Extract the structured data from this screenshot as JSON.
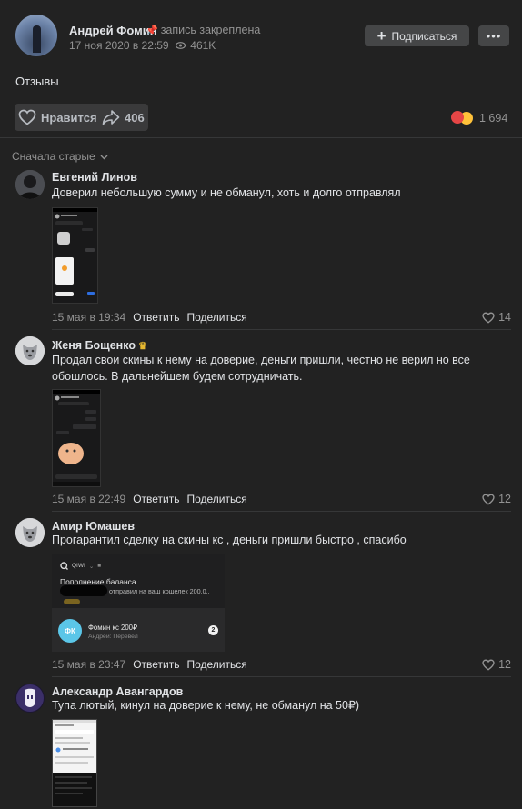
{
  "post": {
    "author": "Андрей Фомин",
    "pinned_label": "запись закреплена",
    "date": "17 ноя 2020 в 22:59",
    "views": "461K",
    "subscribe_label": "Подписаться",
    "more_label": "•••",
    "text": "Отзывы",
    "like_label": "Нравится",
    "share_count": "406",
    "reactions_count": "1 694"
  },
  "sort_label": "Сначала старые",
  "comments": [
    {
      "name": "Евгений Линов",
      "text": "Доверил небольшую сумму и не обманул, хоть и долго отправлял",
      "date": "15 мая в 19:34",
      "reply": "Ответить",
      "share": "Поделиться",
      "likes": "14"
    },
    {
      "name": "Женя Бощенко",
      "text": "Продал свои скины к нему на доверие, деньги пришли, честно не верил но все обошлось. В дальнейшем будем сотрудничать.",
      "date": "15 мая в 22:49",
      "reply": "Ответить",
      "share": "Поделиться",
      "likes": "12"
    },
    {
      "name": "Амир Юмашев",
      "text": "Прогарантил сделку на скины кс , деньги пришли быстро , спасибо",
      "date": "15 мая в 23:47",
      "reply": "Ответить",
      "share": "Поделиться",
      "likes": "12",
      "attachment": {
        "app": "QIWI",
        "title": "Пополнение баланса",
        "line": "отправил на ваш кошелек 200.0..",
        "avatar_initials": "ФК",
        "chat_title": "Фомин кс 200₽",
        "chat_sub": "Андрей: Перевел",
        "unread": "2"
      }
    },
    {
      "name": "Александр Авангардов",
      "text": "Тупа лютый, кинул на доверие к нему, не обманул на 50₽)"
    }
  ]
}
